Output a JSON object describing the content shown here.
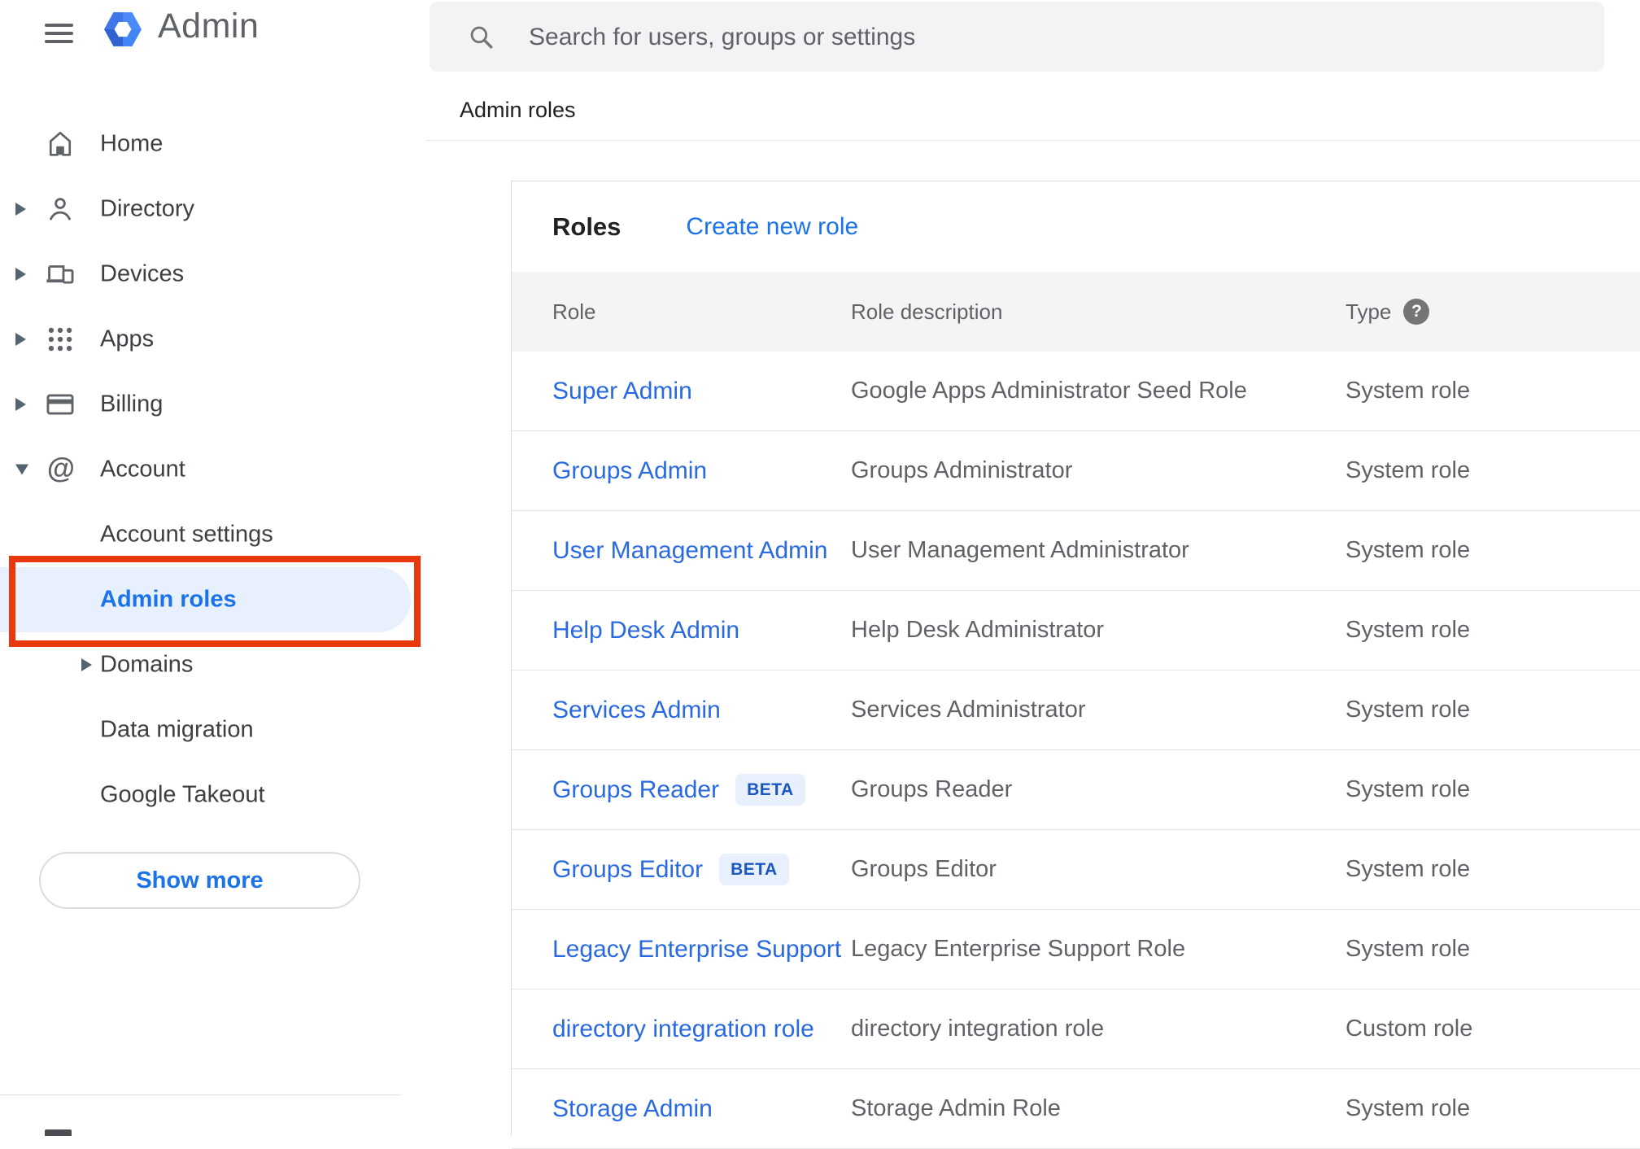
{
  "app": {
    "title": "Admin"
  },
  "search": {
    "placeholder": "Search for users, groups or settings"
  },
  "breadcrumb": "Admin roles",
  "sidebar": {
    "items": [
      {
        "label": "Home",
        "icon": "home",
        "expand": "none",
        "indent": false,
        "active": false
      },
      {
        "label": "Directory",
        "icon": "person",
        "expand": "right",
        "indent": false,
        "active": false
      },
      {
        "label": "Devices",
        "icon": "devices",
        "expand": "right",
        "indent": false,
        "active": false
      },
      {
        "label": "Apps",
        "icon": "apps",
        "expand": "right",
        "indent": false,
        "active": false
      },
      {
        "label": "Billing",
        "icon": "card",
        "expand": "right",
        "indent": false,
        "active": false
      },
      {
        "label": "Account",
        "icon": "at",
        "expand": "down",
        "indent": false,
        "active": false
      },
      {
        "label": "Account settings",
        "icon": "",
        "expand": "none",
        "indent": true,
        "active": false
      },
      {
        "label": "Admin roles",
        "icon": "",
        "expand": "none",
        "indent": true,
        "active": true
      },
      {
        "label": "Domains",
        "icon": "",
        "expand": "right",
        "indent": true,
        "active": false
      },
      {
        "label": "Data migration",
        "icon": "",
        "expand": "none",
        "indent": true,
        "active": false
      },
      {
        "label": "Google Takeout",
        "icon": "",
        "expand": "none",
        "indent": true,
        "active": false
      }
    ],
    "show_more_label": "Show more"
  },
  "content": {
    "card_title": "Roles",
    "create_link": "Create new role",
    "table": {
      "columns": [
        "Role",
        "Role description",
        "Type"
      ],
      "type_help_glyph": "?",
      "beta_label": "BETA",
      "rows": [
        {
          "role": "Super Admin",
          "beta": false,
          "description": "Google Apps Administrator Seed Role",
          "type": "System role"
        },
        {
          "role": "Groups Admin",
          "beta": false,
          "description": "Groups Administrator",
          "type": "System role"
        },
        {
          "role": "User Management Admin",
          "beta": false,
          "description": "User Management Administrator",
          "type": "System role"
        },
        {
          "role": "Help Desk Admin",
          "beta": false,
          "description": "Help Desk Administrator",
          "type": "System role"
        },
        {
          "role": "Services Admin",
          "beta": false,
          "description": "Services Administrator",
          "type": "System role"
        },
        {
          "role": "Groups Reader",
          "beta": true,
          "description": "Groups Reader",
          "type": "System role"
        },
        {
          "role": "Groups Editor",
          "beta": true,
          "description": "Groups Editor",
          "type": "System role"
        },
        {
          "role": "Legacy Enterprise Support",
          "beta": false,
          "description": "Legacy Enterprise Support Role",
          "type": "System role"
        },
        {
          "role": "directory integration role",
          "beta": false,
          "description": "directory integration role",
          "type": "Custom role"
        },
        {
          "role": "Storage Admin",
          "beta": false,
          "description": "Storage Admin Role",
          "type": "System role"
        }
      ]
    }
  },
  "colors": {
    "accent_blue": "#1a73e8",
    "link_blue": "#2a6ae0",
    "active_pill": "#e8f0fe",
    "annotation_red": "#e8380c",
    "beta_bg": "#e8f0fe",
    "beta_text": "#1a56c4",
    "header_bg": "#f4f4f4",
    "divider": "#e3e3e3",
    "text_gray": "#5f6368"
  }
}
